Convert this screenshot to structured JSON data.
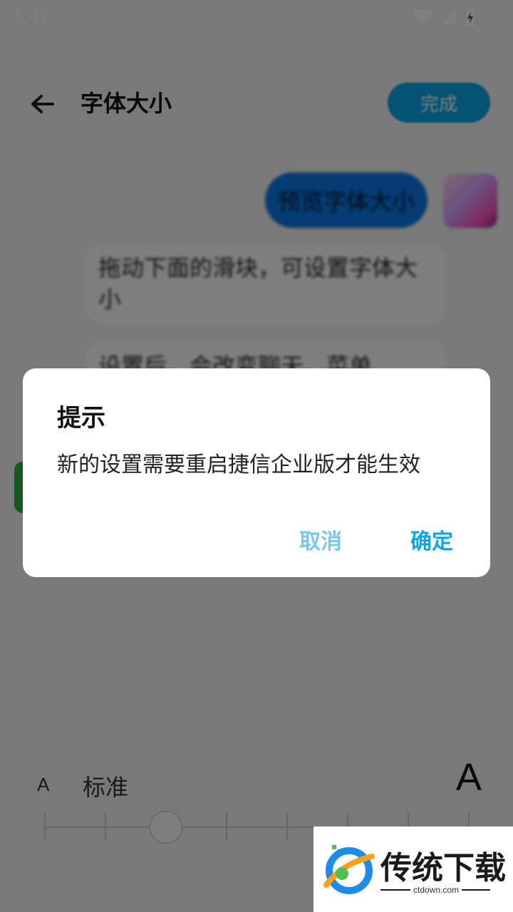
{
  "status_bar": {
    "time": "1:47"
  },
  "topbar": {
    "title": "字体大小",
    "done_label": "完成"
  },
  "chat": {
    "preview_bubble": "预览字体大小",
    "messages": [
      "拖动下面的滑块，可设置字体大小",
      "设置后，会改变聊天、菜单"
    ]
  },
  "slider": {
    "small_label": "A",
    "size_label": "标准",
    "large_label": "A",
    "level": 2,
    "levels_total": 8
  },
  "dialog": {
    "title": "提示",
    "message": "新的设置需要重启捷信企业版才能生效",
    "cancel_label": "取消",
    "confirm_label": "确定"
  },
  "watermark": {
    "text": "传统下载",
    "domain": "ctdown.com"
  },
  "colors": {
    "accent": "#0aa6e8",
    "cancel": "#78c8ea",
    "preview_bubble": "#0a78e2"
  }
}
